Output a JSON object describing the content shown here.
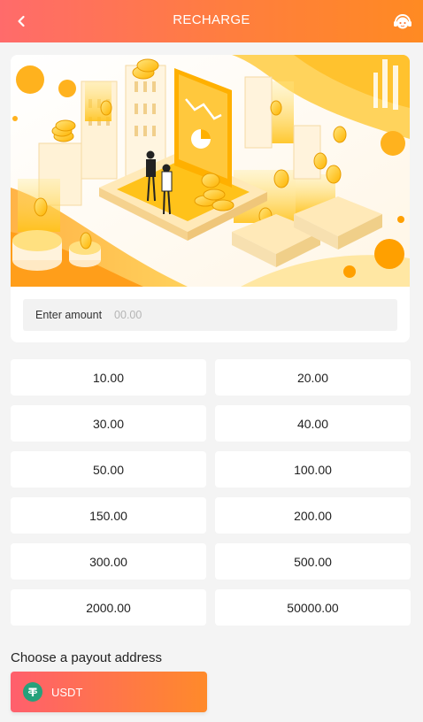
{
  "header": {
    "title": "RECHARGE",
    "back_icon": "chevron-left-icon",
    "support_icon": "customer-service-icon"
  },
  "amount": {
    "label": "Enter amount",
    "placeholder": "00.00"
  },
  "presets": [
    "10.00",
    "20.00",
    "30.00",
    "40.00",
    "50.00",
    "100.00",
    "150.00",
    "200.00",
    "300.00",
    "500.00",
    "2000.00",
    "50000.00"
  ],
  "payout": {
    "title": "Choose a payout address",
    "selected": "USDT",
    "icon": "tether-icon"
  },
  "colors": {
    "header_start": "#ff6b6b",
    "header_end": "#ff8a22",
    "usdt": "#26a17b"
  }
}
